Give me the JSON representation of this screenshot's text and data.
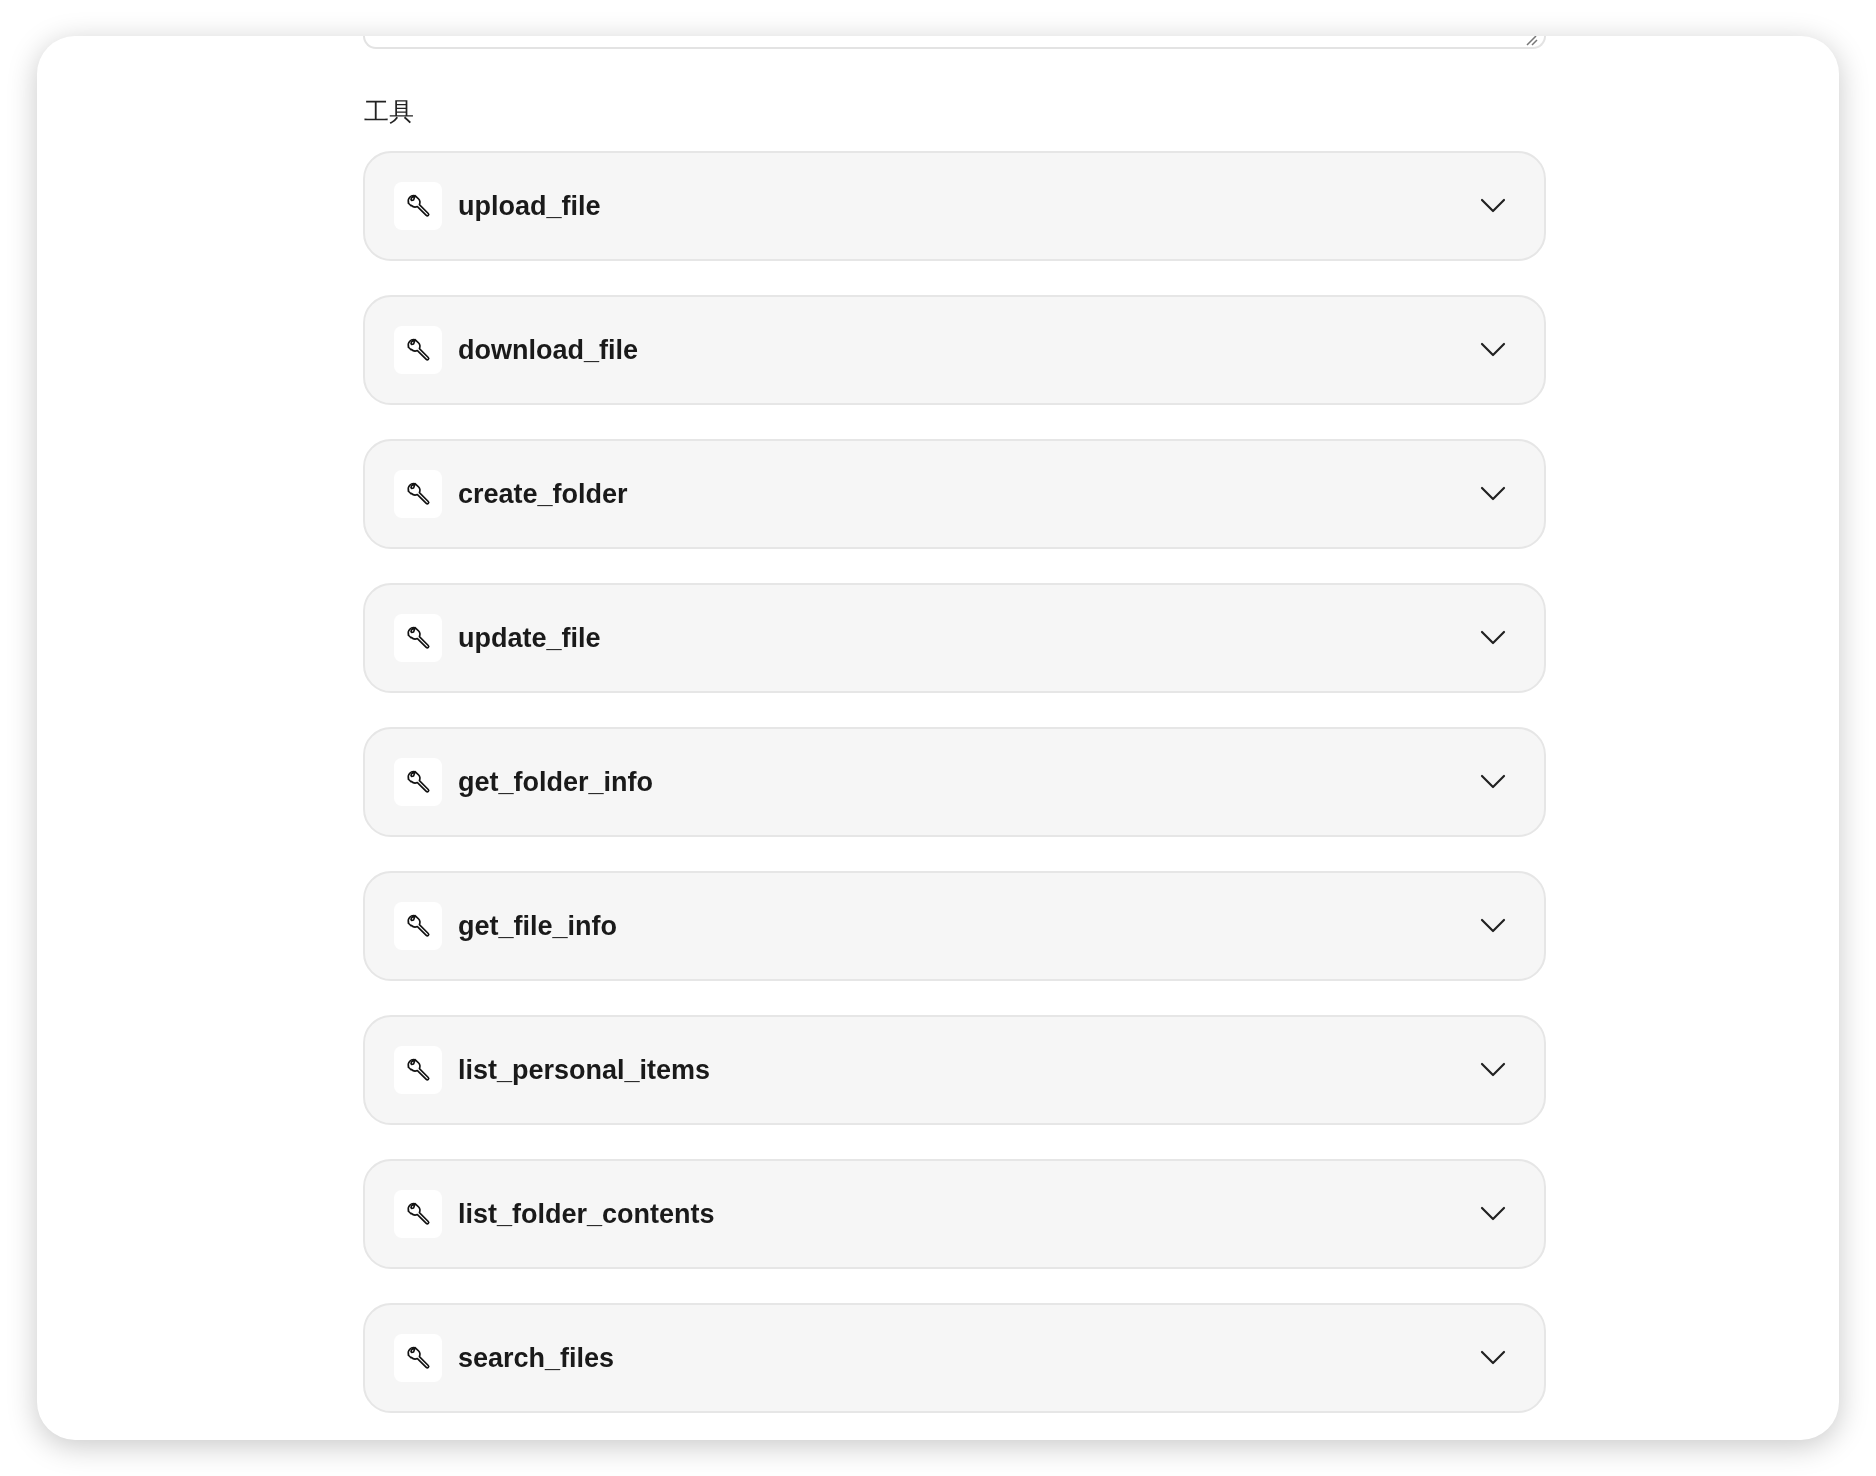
{
  "section_title": "工具",
  "tools": [
    {
      "name": "upload_file",
      "expanded": false
    },
    {
      "name": "download_file",
      "expanded": false
    },
    {
      "name": "create_folder",
      "expanded": false
    },
    {
      "name": "update_file",
      "expanded": false
    },
    {
      "name": "get_folder_info",
      "expanded": false
    },
    {
      "name": "get_file_info",
      "expanded": false
    },
    {
      "name": "list_personal_items",
      "expanded": false
    },
    {
      "name": "list_folder_contents",
      "expanded": false
    },
    {
      "name": "search_files",
      "expanded": false
    }
  ]
}
